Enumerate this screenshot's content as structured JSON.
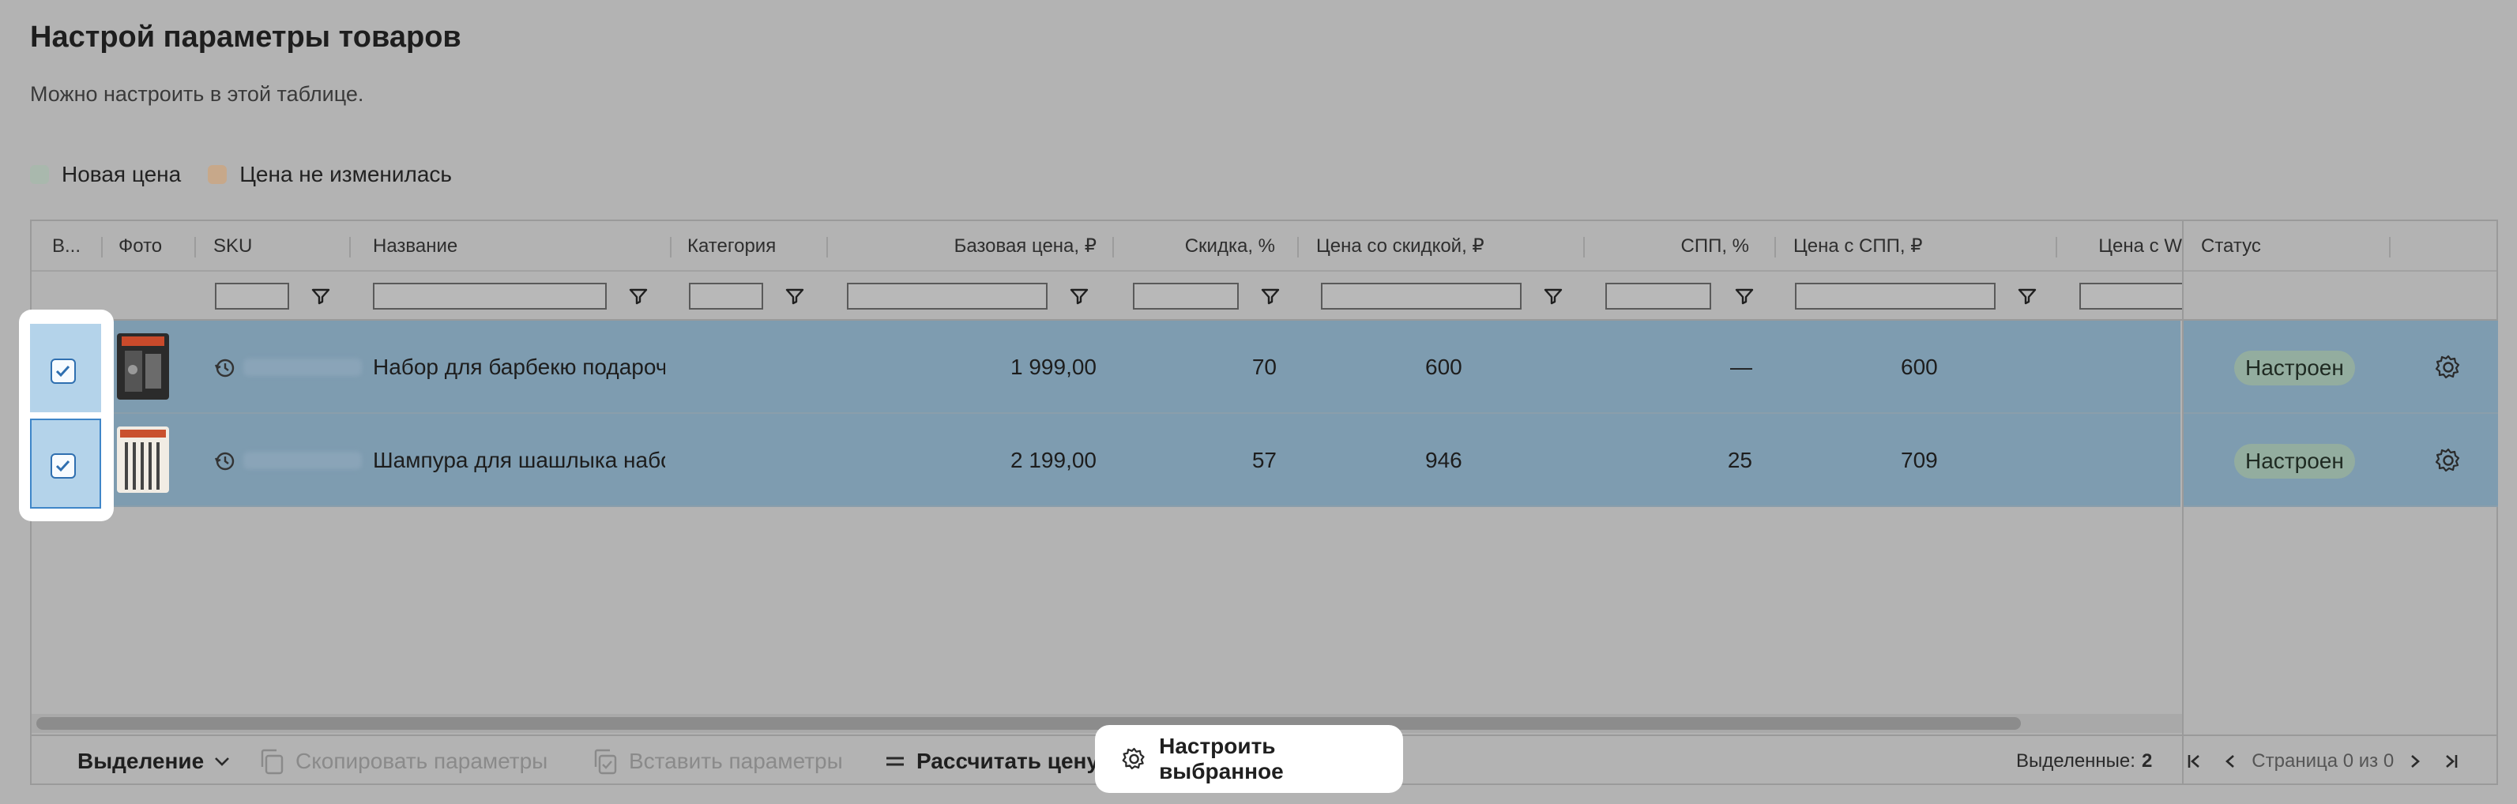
{
  "page": {
    "title": "Настрой параметры товаров",
    "subtitle": "Можно настроить в этой таблице."
  },
  "legend": [
    {
      "label": "Новая цена",
      "color": "#a9b8ad"
    },
    {
      "label": "Цена не изменилась",
      "color": "#c7a88a"
    }
  ],
  "columns": {
    "select": "В...",
    "photo": "Фото",
    "sku": "SKU",
    "name": "Название",
    "category": "Категория",
    "base_price": "Базовая цена, ₽",
    "discount": "Скидка, %",
    "discount_price": "Цена со скидкой, ₽",
    "spp": "СПП, %",
    "spp_price": "Цена с СПП, ₽",
    "price_w": "Цена с W",
    "status": "Статус"
  },
  "rows": [
    {
      "checked": true,
      "name": "Набор для барбекю подароч",
      "base_price": "1 999,00",
      "discount": "70",
      "discount_price": "600",
      "spp": "—",
      "spp_price": "600",
      "status": "Настроен"
    },
    {
      "checked": true,
      "name": "Шампура для шашлыка набо",
      "base_price": "2 199,00",
      "discount": "57",
      "discount_price": "946",
      "spp": "25",
      "spp_price": "709",
      "status": "Настроен"
    }
  ],
  "toolbar": {
    "selection": "Выделение",
    "copy": "Скопировать параметры",
    "paste": "Вставить параметры",
    "calculate": "Рассчитать цену",
    "configure": "Настроить выбранное"
  },
  "footer": {
    "selected_label": "Выделенные:",
    "selected_count": "2",
    "page_info": "Страница 0 из 0"
  },
  "colors": {
    "row_selected": "#7e9cb0",
    "status_badge": "#93ad9f",
    "checkbox_accent": "#2f6fb0"
  }
}
